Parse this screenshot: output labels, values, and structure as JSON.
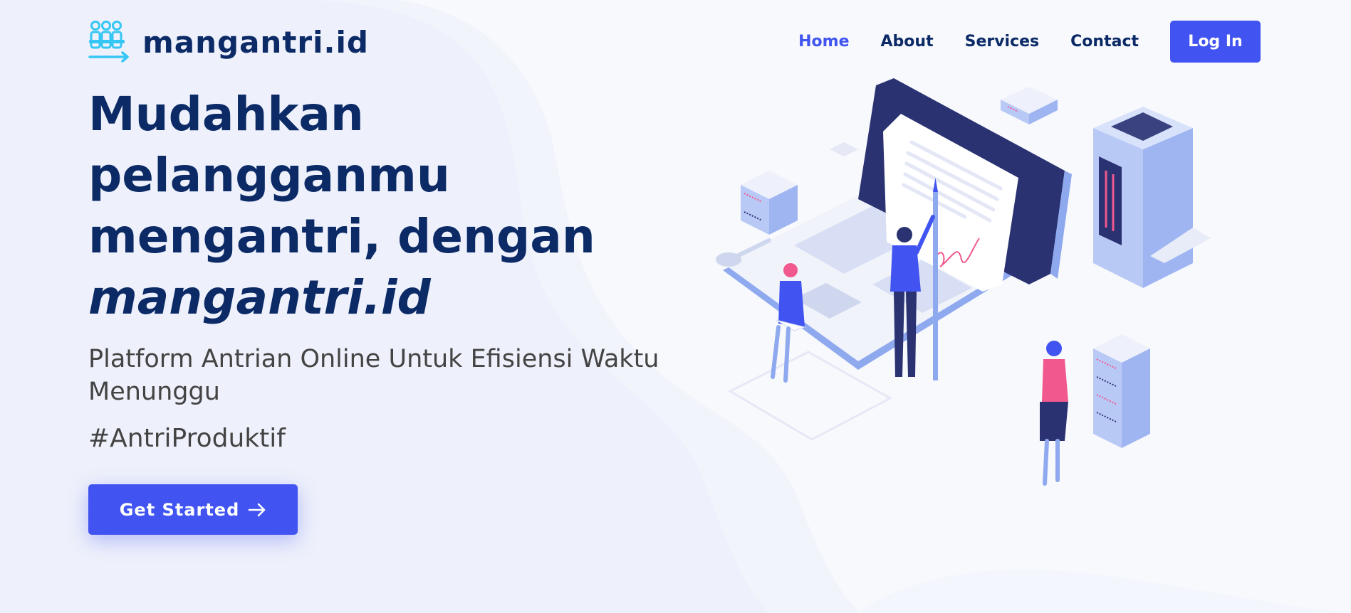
{
  "header": {
    "logo_text": "mangantri.id",
    "nav": [
      {
        "label": "Home",
        "active": true
      },
      {
        "label": "About",
        "active": false
      },
      {
        "label": "Services",
        "active": false
      },
      {
        "label": "Contact",
        "active": false
      }
    ],
    "login_label": "Log In"
  },
  "hero": {
    "title_line1": "Mudahkan",
    "title_line2": "pelangganmu",
    "title_line3": "mengantri, dengan",
    "title_brand": "mangantri.id",
    "subtitle": "Platform Antrian Online Untuk Efisiensi Waktu Menunggu",
    "hashtag": "#AntriProduktif",
    "cta_label": "Get Started"
  },
  "colors": {
    "primary": "#4154f1",
    "heading": "#0b2a66",
    "body_text": "#444444",
    "accent_pink": "#f0588e",
    "logo_cyan": "#36c6f4"
  },
  "icons": {
    "logo": "people-queue-icon",
    "cta_arrow": "arrow-right-icon"
  }
}
